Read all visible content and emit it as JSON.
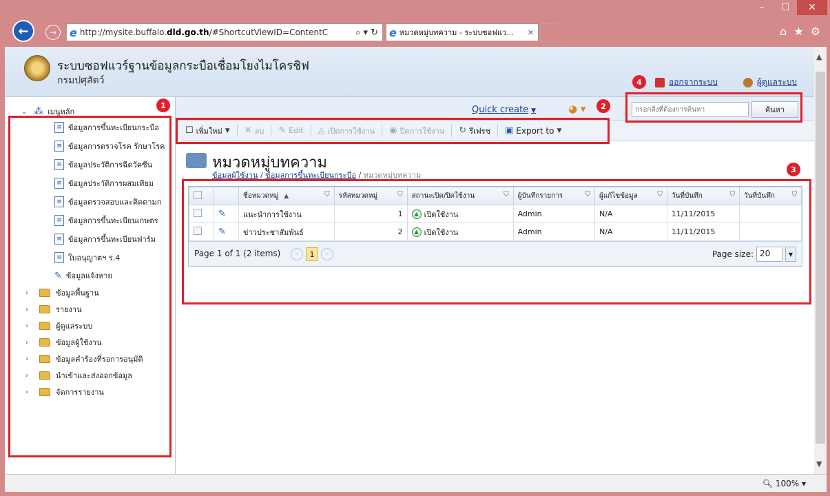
{
  "browser": {
    "url_prefix": "http://mysite.buffalo.",
    "url_host": "dld.go.th",
    "url_rest": "/#ShortcutViewID=ContentC",
    "url_tools": "⌕ ▾ ↻",
    "tab_title": "หมวดหมู่บทความ - ระบบซอฟแว...",
    "zoom": "100%"
  },
  "header": {
    "title": "ระบบซอฟแวร์ฐานข้อมูลกระบือเชื่อมโยงไมโครชิฟ",
    "subtitle": "กรมปศุสัตว์",
    "logout_label": "ออกจากระบบ",
    "admin_label": "ผู้ดูแลระบบ"
  },
  "quickbar": {
    "quick_create": "Quick create",
    "search_placeholder": "กรอกสิ่งที่ต้องการค้นหา",
    "search_button": "ค้นหา"
  },
  "sidebar": {
    "root": "เมนูหลัก",
    "sub_items": [
      "ข้อมูลการขึ้นทะเบียนกระบือ",
      "ข้อมูลการตรวจโรค รักษาโรค",
      "ข้อมูลประวัติการฉีดวัคซีน",
      "ข้อมูลประวัติการผสมเทียม",
      "ข้อมูลตรวจสอบและติดตามก",
      "ข้อมูลการขึ้นทะเบียนเกษตร",
      "ข้อมูลการขึ้นทะเบียนฟาร์ม",
      "ใบอนุญาตฯ ร.4",
      "ข้อมูลแจ้งหาย"
    ],
    "groups": [
      "ข้อมูลพื้นฐาน",
      "รายงาน",
      "ผู้ดูแลระบบ",
      "ข้อมูลผู้ใช้งาน",
      "ข้อมูลคำร้องที่รอการอนุมัติ",
      "นำเข้าและส่งออกข้อมูล",
      "จัดการรายงาน"
    ]
  },
  "toolbar": {
    "new": "เพิ่มใหม่",
    "delete": "ลบ",
    "edit": "Edit",
    "enable": "เปิดการใช้งาน",
    "disable": "ปิดการใช้งาน",
    "refresh": "รีเฟรช",
    "export": "Export to"
  },
  "page": {
    "title": "หมวดหมู่บทความ",
    "breadcrumb": [
      "ข้อมูลผู้ใช้งาน",
      "ข้อมูลการขึ้นทะเบียนกระบือ",
      "หมวดหมู่บทความ"
    ]
  },
  "grid": {
    "columns": [
      "ชื่อหมวดหมู่",
      "รหัสหมวดหมู่",
      "สถานะเปิด/ปิดใช้งาน",
      "ผู้บันทึกรายการ",
      "ผู้แก้ไขข้อมูล",
      "วันที่บันทึก",
      "วันที่บันทึก"
    ],
    "rows": [
      {
        "name": "แนะนำการใช้งาน",
        "code": "1",
        "status": "เปิดใช้งาน",
        "creator": "Admin",
        "editor": "N/A",
        "created": "11/11/2015",
        "updated": ""
      },
      {
        "name": "ข่าวประชาสัมพันธ์",
        "code": "2",
        "status": "เปิดใช้งาน",
        "creator": "Admin",
        "editor": "N/A",
        "created": "11/11/2015",
        "updated": ""
      }
    ],
    "pager_summary": "Page 1 of 1 (2 items)",
    "current_page": "1",
    "page_size_label": "Page size:",
    "page_size": "20"
  },
  "annotations": [
    "1",
    "2",
    "3",
    "4"
  ],
  "colors": {
    "annotation": "#e0202a",
    "link": "#1a3e8c",
    "chrome": "#d4898a"
  }
}
